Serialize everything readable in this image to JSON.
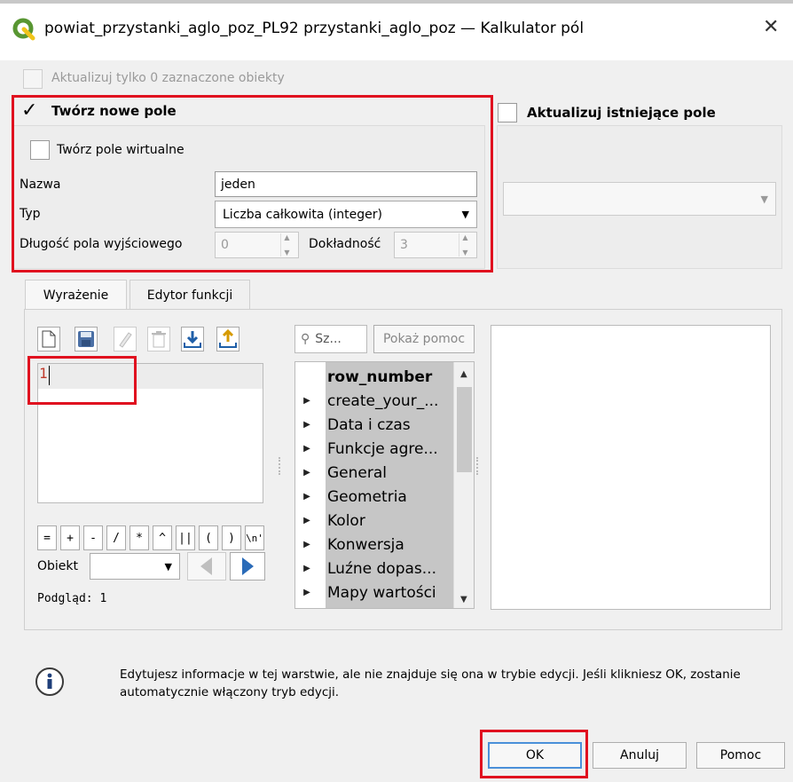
{
  "window": {
    "title": "powiat_przystanki_aglo_poz_PL92 przystanki_aglo_poz — Kalkulator pól",
    "close_glyph": "✕"
  },
  "options": {
    "update_selected_label": "Aktualizuj tylko 0 zaznaczone obiekty",
    "create_new_field_label": "Twórz nowe pole",
    "create_new_field_checked": true,
    "update_existing_label": "Aktualizuj istniejące pole",
    "virtual_field_label": "Twórz pole wirtualne"
  },
  "new_field": {
    "name_label": "Nazwa",
    "name_value": "jeden",
    "type_label": "Typ",
    "type_value": "Liczba całkowita (integer)",
    "length_label": "Długość pola wyjściowego",
    "length_value": "0",
    "precision_label": "Dokładność",
    "precision_value": "3"
  },
  "tabs": [
    {
      "label": "Wyrażenie"
    },
    {
      "label": "Edytor funkcji"
    }
  ],
  "expression": {
    "value": "1",
    "operators": [
      "=",
      "+",
      "-",
      "/",
      "*",
      "^",
      "||",
      "(",
      ")",
      "\\n'"
    ],
    "feature_label": "Obiekt",
    "preview_label": "Podgląd:",
    "preview_value": "1"
  },
  "functions": {
    "search_placeholder": "Sz...",
    "show_help_label": "Pokaż pomoc",
    "items": [
      {
        "label": "row_number"
      },
      {
        "label": "create_your_..."
      },
      {
        "label": "Data i czas"
      },
      {
        "label": "Funkcje agre..."
      },
      {
        "label": "General"
      },
      {
        "label": "Geometria"
      },
      {
        "label": "Kolor"
      },
      {
        "label": "Konwersja"
      },
      {
        "label": "Luźne dopas..."
      },
      {
        "label": "Mapy wartości"
      }
    ]
  },
  "info": {
    "message": "Edytujesz informacje w tej warstwie, ale nie znajduje się ona w trybie edycji. Jeśli klikniesz OK, zostanie automatycznie włączony tryb edycji."
  },
  "buttons": {
    "ok": "OK",
    "cancel": "Anuluj",
    "help": "Pomoc"
  },
  "colors": {
    "highlight": "#e0101f",
    "qgis_green": "#589632",
    "qgis_yellow": "#f0c419",
    "nav_blue": "#1f5fa8"
  }
}
